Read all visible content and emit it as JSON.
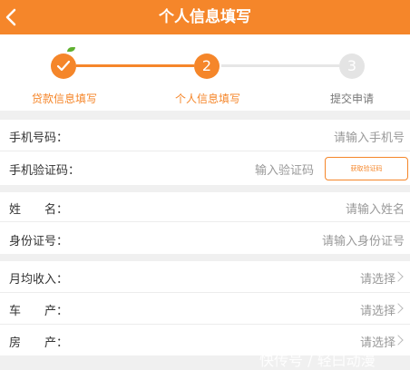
{
  "header": {
    "title": "个人信息填写",
    "back_icon": "chevron-left-icon",
    "bg_color": "#f5862a"
  },
  "steps": [
    {
      "label": "贷款信息填写",
      "marker": "✓",
      "state": "done"
    },
    {
      "label": "个人信息填写",
      "marker": "2",
      "state": "current"
    },
    {
      "label": "提交申请",
      "marker": "3",
      "state": "pending"
    }
  ],
  "form": {
    "phone": {
      "label": "手机号码：",
      "placeholder": "请输入手机号"
    },
    "code": {
      "label": "手机验证码：",
      "placeholder": "输入验证码",
      "button": "获取验证码"
    },
    "name": {
      "label": "姓　　名：",
      "placeholder": "请输入姓名"
    },
    "id_card": {
      "label": "身份证号：",
      "placeholder": "请输入身份证号"
    },
    "income": {
      "label": "月均收入：",
      "value": "请选择"
    },
    "car": {
      "label": "车　　产：",
      "value": "请选择"
    },
    "house": {
      "label": "房　　产：",
      "value": "请选择"
    }
  },
  "watermark": "快传号 / 轻曰动漫",
  "colors": {
    "accent": "#f5862a",
    "pending": "#e4e4e4",
    "background": "#f0f0f0"
  }
}
